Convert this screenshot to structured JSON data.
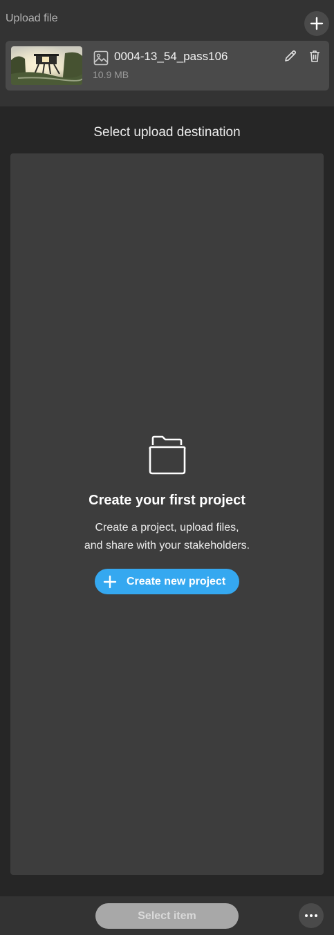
{
  "header": {
    "title": "Upload file",
    "add_icon": "plus-icon"
  },
  "file": {
    "name": "0004-13_54_pass106",
    "size": "10.9 MB",
    "type_icon": "image-icon",
    "actions": [
      "pencil-icon",
      "trash-icon"
    ]
  },
  "destination": {
    "title": "Select upload destination",
    "empty_icon": "folder-open-icon",
    "empty_title": "Create your first project",
    "empty_desc_line1": "Create a project, upload files,",
    "empty_desc_line2": "and share with your stakeholders.",
    "create_label": "Create new project"
  },
  "footer": {
    "select_label": "Select item",
    "more_icon": "more-icon"
  },
  "colors": {
    "accent": "#35a8f0",
    "background": "#262626",
    "panel": "#3d3d3d",
    "card": "#4a4a4a",
    "disabled_button": "#a8a8a8"
  }
}
